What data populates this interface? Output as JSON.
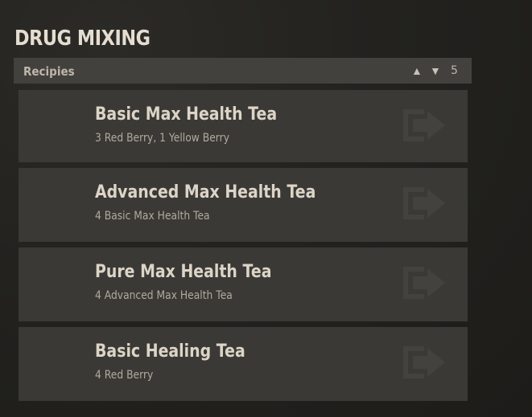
{
  "title": "DRUG MIXING",
  "panel": {
    "label": "Recipies",
    "nav_up": "▲",
    "nav_down": "▼",
    "count": "5"
  },
  "recipes": [
    {
      "name": "Basic Max Health Tea",
      "ingredients": "3 Red Berry, 1 Yellow Berry",
      "icon": "craft-arrow-icon"
    },
    {
      "name": "Advanced Max Health Tea",
      "ingredients": "4 Basic Max Health Tea",
      "icon": "craft-arrow-icon"
    },
    {
      "name": "Pure Max Health Tea",
      "ingredients": "4 Advanced Max Health Tea",
      "icon": "craft-arrow-icon"
    },
    {
      "name": "Basic Healing Tea",
      "ingredients": "4 Red Berry",
      "icon": "craft-arrow-icon"
    }
  ]
}
